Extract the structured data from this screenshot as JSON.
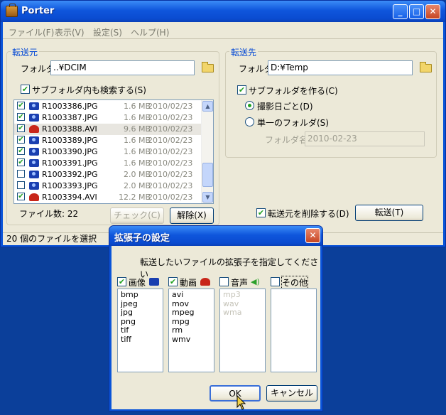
{
  "app": {
    "title": "Porter",
    "window_buttons": {
      "minimize": "_",
      "maximize": "□",
      "close": "✕"
    }
  },
  "menu": [
    "ファイル(F)",
    "表示(V)",
    "設定(S)",
    "ヘルプ(H)"
  ],
  "source": {
    "group_title": "転送元",
    "folder_label": "フォルダ",
    "folder_value": "..¥DCIM",
    "subfolder_search_label": "サブフォルダ内も検索する(S)",
    "subfolder_search_checked": true,
    "files": [
      {
        "name": "R1003386.JPG",
        "size": "1.6 MB",
        "date": "2010/02/23",
        "checked": true,
        "type": "camera"
      },
      {
        "name": "R1003387.JPG",
        "size": "1.6 MB",
        "date": "2010/02/23",
        "checked": true,
        "type": "camera"
      },
      {
        "name": "R1003388.AVI",
        "size": "9.6 MB",
        "date": "2010/02/23",
        "checked": true,
        "type": "video",
        "selected": true
      },
      {
        "name": "R1003389.JPG",
        "size": "1.6 MB",
        "date": "2010/02/23",
        "checked": true,
        "type": "camera"
      },
      {
        "name": "R1003390.JPG",
        "size": "1.6 MB",
        "date": "2010/02/23",
        "checked": true,
        "type": "camera"
      },
      {
        "name": "R1003391.JPG",
        "size": "1.6 MB",
        "date": "2010/02/23",
        "checked": true,
        "type": "camera"
      },
      {
        "name": "R1003392.JPG",
        "size": "2.0 MB",
        "date": "2010/02/23",
        "checked": false,
        "type": "camera"
      },
      {
        "name": "R1003393.JPG",
        "size": "2.0 MB",
        "date": "2010/02/23",
        "checked": false,
        "type": "camera"
      },
      {
        "name": "R1003394.AVI",
        "size": "12.2 MB",
        "date": "2010/02/23",
        "checked": true,
        "type": "video"
      }
    ],
    "file_count_label": "ファイル数: 22",
    "check_button": "チェック(C)",
    "uncheck_button": "解除(X)"
  },
  "destination": {
    "group_title": "転送先",
    "folder_label": "フォルダ",
    "folder_value": "D:¥Temp",
    "make_subfolder_label": "サブフォルダを作る(C)",
    "make_subfolder_checked": true,
    "radio_by_date_label": "撮影日ごと(D)",
    "radio_single_label": "単一のフォルダ(S)",
    "selected_radio": "by_date",
    "folder_name_label": "フォルダ名",
    "folder_name_value": "2010-02-23",
    "delete_source_label": "転送元を削除する(D)",
    "delete_source_checked": true,
    "transfer_button": "転送(T)"
  },
  "status": {
    "text": "20 個のファイルを選択"
  },
  "dialog": {
    "title": "拡張子の設定",
    "instruction": "転送したいファイルの拡張子を指定してください",
    "categories": [
      {
        "label": "画像",
        "checked": true,
        "icon": "camera-icon",
        "extensions": [
          "bmp",
          "jpeg",
          "jpg",
          "png",
          "tif",
          "tiff"
        ],
        "enabled": true
      },
      {
        "label": "動画",
        "checked": true,
        "icon": "video-icon",
        "extensions": [
          "avi",
          "mov",
          "mpeg",
          "mpg",
          "rm",
          "wmv"
        ],
        "enabled": true
      },
      {
        "label": "音声",
        "checked": false,
        "icon": "speaker-icon",
        "extensions": [
          "mp3",
          "wav",
          "wma"
        ],
        "enabled": false
      },
      {
        "label": "その他",
        "checked": false,
        "icon": "",
        "extensions": [],
        "enabled": true
      }
    ],
    "ok_button": "OK",
    "cancel_button": "キャンセル",
    "close_button": "✕"
  },
  "colors": {
    "accent": "#0046d5",
    "check": "#21a121",
    "camera": "#1a3fb0",
    "video": "#c8261a"
  }
}
